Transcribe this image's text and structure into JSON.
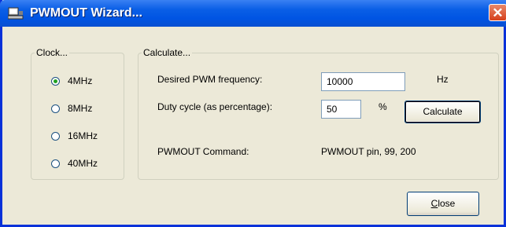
{
  "window": {
    "title": "PWMOUT Wizard...",
    "close_glyph": "✕"
  },
  "clock": {
    "legend": "Clock...",
    "options": [
      {
        "label": "4MHz",
        "checked": true
      },
      {
        "label": "8MHz",
        "checked": false
      },
      {
        "label": "16MHz",
        "checked": false
      },
      {
        "label": "40MHz",
        "checked": false
      }
    ]
  },
  "calculate": {
    "legend": "Calculate...",
    "frequency_label": "Desired PWM frequency:",
    "frequency_value": "10000",
    "frequency_unit": "Hz",
    "duty_label": "Duty cycle (as percentage):",
    "duty_value": "50",
    "duty_unit": "%",
    "calculate_button": "Calculate",
    "command_label": "PWMOUT Command:",
    "command_value": "PWMOUT pin, 99, 200"
  },
  "close_button": "Close"
}
